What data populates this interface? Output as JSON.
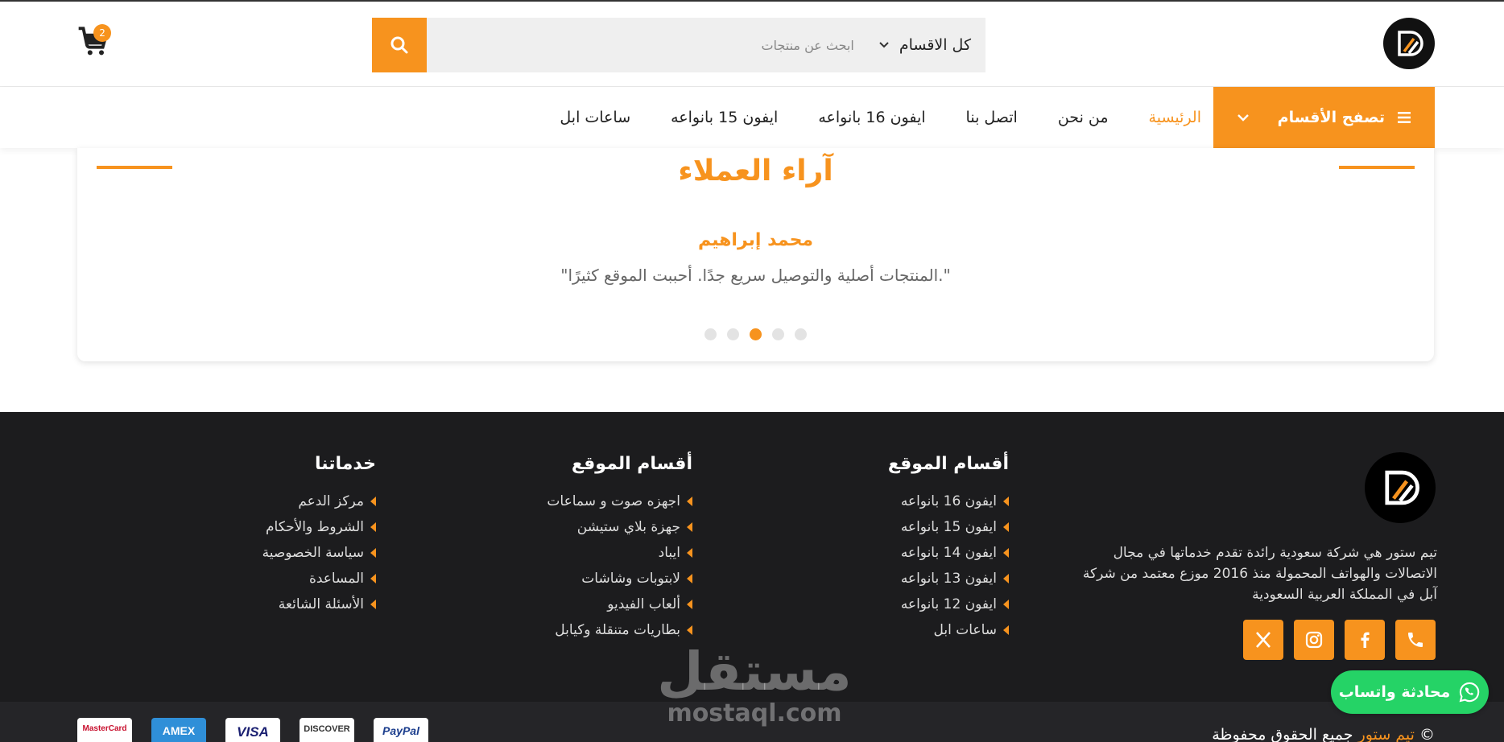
{
  "header": {
    "cart_count": "2",
    "search": {
      "category": "كل الاقسام",
      "placeholder": "ابحث عن منتجات"
    }
  },
  "nav": {
    "browse_label": "تصفح الأقسام",
    "links": [
      "الرئيسية",
      "من نحن",
      "اتصل بنا",
      "ايفون 16 بانواعه",
      "ايفون 15 بانواعه",
      "ساعات ابل"
    ]
  },
  "testimonials": {
    "title": "آراء العملاء",
    "name": "محمد إبراهيم",
    "quote": "\".المنتجات أصلية والتوصيل سريع جدًا. أحببت الموقع كثيرًا\"",
    "active_slide": 3,
    "slide_count": 5
  },
  "footer": {
    "about": "تيم ستور هي شركة سعودية رائدة تقدم خدماتها في مجال الاتصالات والهواتف المحمولة منذ 2016 موزع معتمد من شركة آبل في المملكة العربية السعودية",
    "col1": {
      "title": "أقسام الموقع",
      "items": [
        "ايفون 16 بانواعه",
        "ايفون 15 بانواعه",
        "ايفون 14 بانواعه",
        "ايفون 13 بانواعه",
        "ايفون 12 بانواعه",
        "ساعات ابل"
      ]
    },
    "col2": {
      "title": "أقسام الموقع",
      "items": [
        "اجهزه صوت و سماعات",
        "جهزة بلاي ستيشن",
        "ايباد",
        "لابتوبات وشاشات",
        "ألعاب الفيديو",
        "بطاريات متنقلة وكيابل"
      ]
    },
    "col3": {
      "title": "خدماتنا",
      "items": [
        "مركز الدعم",
        "الشروط والأحكام",
        "سياسة الخصوصية",
        "المساعدة",
        "الأسئلة الشائعة"
      ]
    },
    "copyright_prefix": "©",
    "copyright_brand": "تيم ستور",
    "copyright_suffix": "جميع الحقوق محفوظة",
    "payments": [
      "PayPal",
      "DISCOVER",
      "VISA",
      "AMEX",
      "MasterCard"
    ]
  },
  "whatsapp_label": "محادثة واتساب",
  "watermark": {
    "ar": "مستقل",
    "en": "mostaql.com"
  },
  "colors": {
    "accent": "#f7931e",
    "footer_bg": "#1c1c1e",
    "whatsapp": "#25d366"
  }
}
